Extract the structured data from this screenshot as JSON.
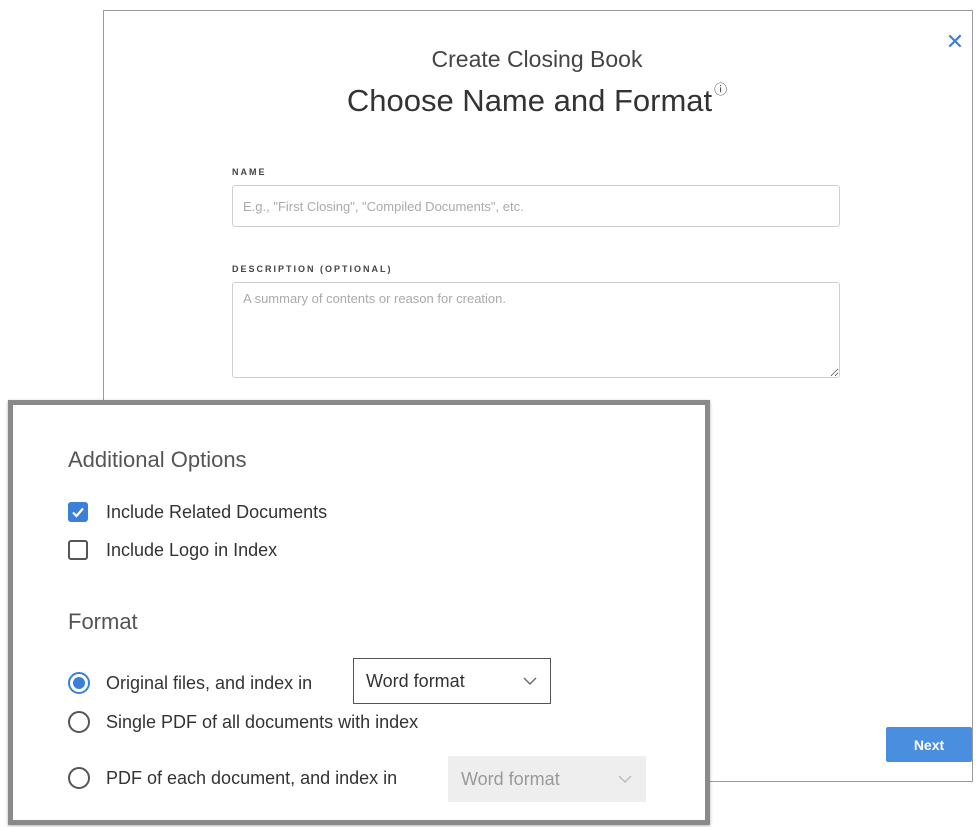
{
  "dialog": {
    "subtitle": "Create Closing Book",
    "title": "Choose Name and Format",
    "info_mark": "ⓘ",
    "close_glyph": "✕"
  },
  "name_field": {
    "label": "NAME",
    "placeholder": "E.g., \"First Closing\", \"Compiled Documents\", etc.",
    "value": ""
  },
  "description_field": {
    "label": "DESCRIPTION (OPTIONAL)",
    "placeholder": "A summary of contents or reason for creation.",
    "value": ""
  },
  "additional_options": {
    "heading": "Additional Options",
    "items": [
      {
        "label": "Include Related Documents",
        "checked": true
      },
      {
        "label": "Include Logo in Index",
        "checked": false
      }
    ]
  },
  "format": {
    "heading": "Format",
    "options": [
      {
        "label": "Original files, and index in",
        "selected": true,
        "dropdown": "Word format",
        "dropdown_enabled": true
      },
      {
        "label": "Single PDF of all documents with index",
        "selected": false
      },
      {
        "label": "PDF of each document, and index in",
        "selected": false,
        "dropdown": "Word format",
        "dropdown_enabled": false
      }
    ]
  },
  "next_button": {
    "label": "Next"
  },
  "colors": {
    "accent": "#3b7fd8",
    "button": "#4a8ee0"
  },
  "icons": {
    "close": "close-icon",
    "check": "check-icon",
    "chevron": "chevron-down-icon",
    "info": "info-icon"
  }
}
